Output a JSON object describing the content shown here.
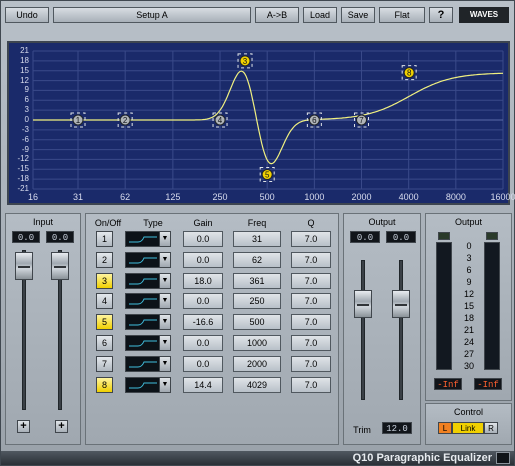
{
  "toolbar": {
    "undo": "Undo",
    "setup": "Setup A",
    "ab": "A->B",
    "load": "Load",
    "save": "Save",
    "flat": "Flat",
    "help": "?",
    "logo": "WAVES"
  },
  "graph": {
    "y_ticks": [
      "21",
      "18",
      "15",
      "12",
      "9",
      "6",
      "3",
      "0",
      "-3",
      "-6",
      "-9",
      "-12",
      "-15",
      "-18",
      "-21"
    ],
    "x_ticks": [
      "16",
      "31",
      "62",
      "125",
      "250",
      "500",
      "1000",
      "2000",
      "4000",
      "8000",
      "16000"
    ],
    "bands": [
      {
        "id": "1",
        "freq": 31,
        "gain": 0,
        "active": false
      },
      {
        "id": "2",
        "freq": 62,
        "gain": 0,
        "active": false
      },
      {
        "id": "3",
        "freq": 361,
        "gain": 18,
        "active": true
      },
      {
        "id": "4",
        "freq": 250,
        "gain": 0,
        "active": false
      },
      {
        "id": "5",
        "freq": 500,
        "gain": -16.6,
        "active": true
      },
      {
        "id": "6",
        "freq": 1000,
        "gain": 0,
        "active": false
      },
      {
        "id": "7",
        "freq": 2000,
        "gain": 0,
        "active": false
      },
      {
        "id": "8",
        "freq": 4029,
        "gain": 14.4,
        "active": true
      }
    ]
  },
  "input": {
    "label": "Input",
    "left": "0.0",
    "right": "0.0",
    "plus": "+"
  },
  "columns": {
    "onoff": "On/Off",
    "type": "Type",
    "gain": "Gain",
    "freq": "Freq",
    "q": "Q"
  },
  "rows": [
    {
      "band": "1",
      "on": false,
      "gain": "0.0",
      "freq": "31",
      "q": "7.0"
    },
    {
      "band": "2",
      "on": false,
      "gain": "0.0",
      "freq": "62",
      "q": "7.0"
    },
    {
      "band": "3",
      "on": true,
      "gain": "18.0",
      "freq": "361",
      "q": "7.0"
    },
    {
      "band": "4",
      "on": false,
      "gain": "0.0",
      "freq": "250",
      "q": "7.0"
    },
    {
      "band": "5",
      "on": true,
      "gain": "-16.6",
      "freq": "500",
      "q": "7.0"
    },
    {
      "band": "6",
      "on": false,
      "gain": "0.0",
      "freq": "1000",
      "q": "7.0"
    },
    {
      "band": "7",
      "on": false,
      "gain": "0.0",
      "freq": "2000",
      "q": "7.0"
    },
    {
      "band": "8",
      "on": true,
      "gain": "14.4",
      "freq": "4029",
      "q": "7.0"
    }
  ],
  "output_fader": {
    "label": "Output",
    "left": "0.0",
    "right": "0.0",
    "trim_label": "Trim",
    "trim_value": "12.0"
  },
  "output_meter": {
    "label": "Output",
    "scale": [
      "0",
      "3",
      "6",
      "9",
      "12",
      "15",
      "18",
      "21",
      "24",
      "27",
      "30"
    ],
    "left_peak": "-Inf",
    "right_peak": "-Inf"
  },
  "control": {
    "label": "Control",
    "l": "L",
    "link": "Link",
    "r": "R"
  },
  "footer": {
    "title": "Q10 Paragraphic Equalizer"
  },
  "colors": {
    "graph_bg": "#1a2a6a",
    "curve": "#f0f080",
    "band_active": "#f0d000"
  }
}
